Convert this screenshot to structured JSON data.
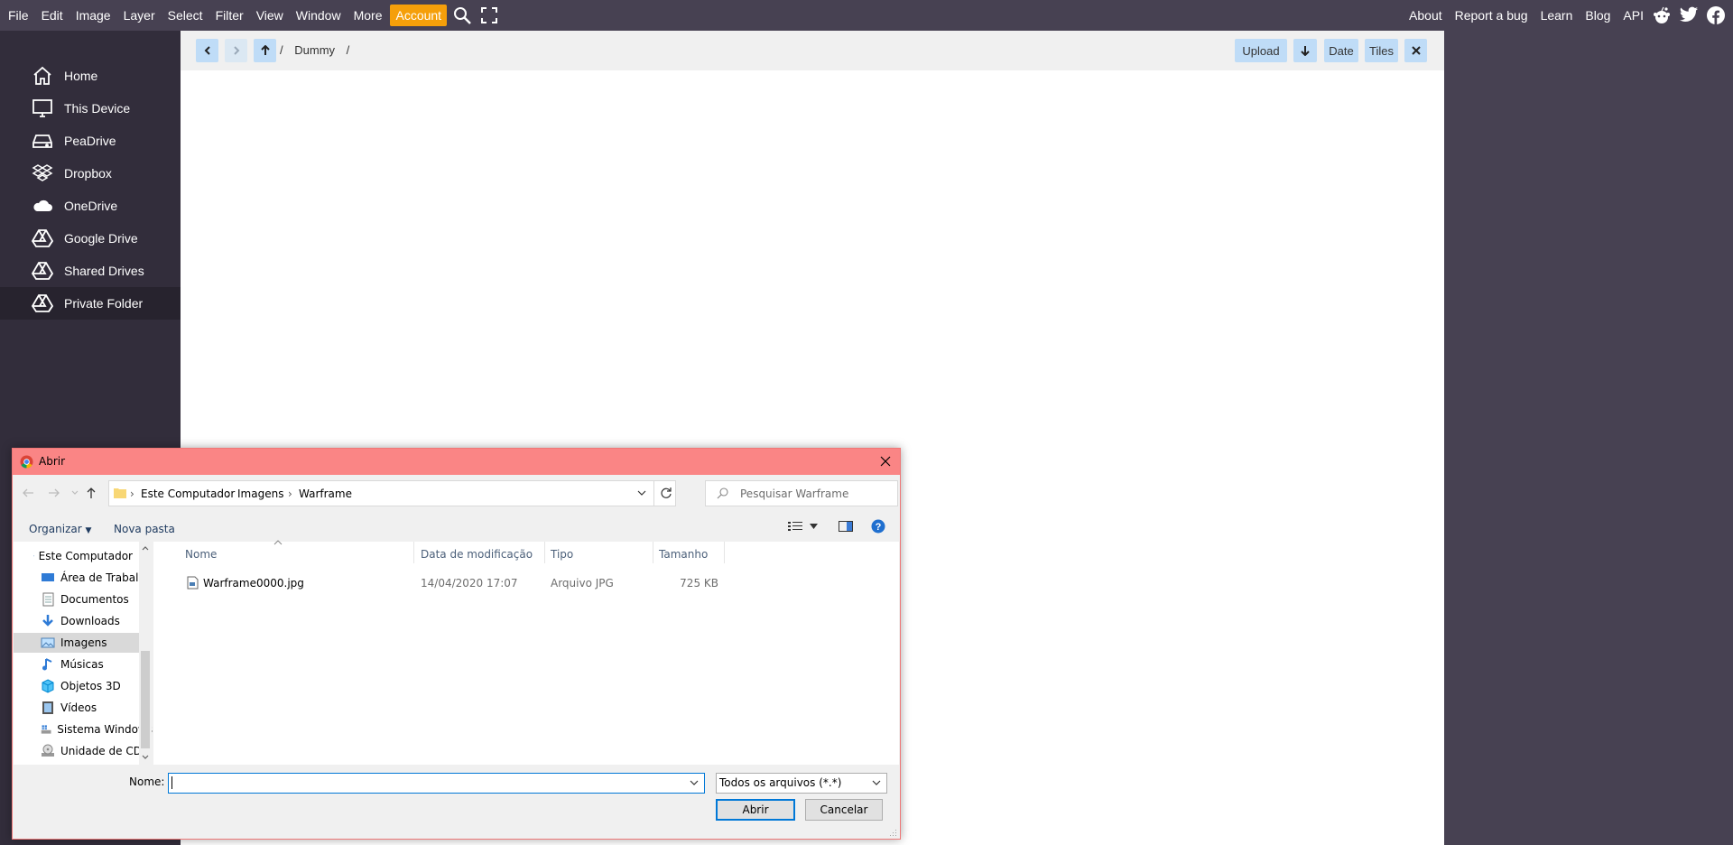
{
  "menubar": {
    "items": [
      "File",
      "Edit",
      "Image",
      "Layer",
      "Select",
      "Filter",
      "View",
      "Window",
      "More"
    ],
    "account": "Account",
    "right_items": [
      "About",
      "Report a bug",
      "Learn",
      "Blog",
      "API"
    ]
  },
  "sidebar": {
    "items": [
      {
        "label": "Home",
        "icon": "home-icon"
      },
      {
        "label": "This Device",
        "icon": "monitor-icon"
      },
      {
        "label": "PeaDrive",
        "icon": "drive-icon"
      },
      {
        "label": "Dropbox",
        "icon": "dropbox-icon"
      },
      {
        "label": "OneDrive",
        "icon": "cloud-icon"
      },
      {
        "label": "Google Drive",
        "icon": "google-drive-icon"
      },
      {
        "label": "Shared Drives",
        "icon": "google-drive-icon"
      },
      {
        "label": "Private Folder",
        "icon": "google-drive-icon"
      }
    ],
    "active_index": 7
  },
  "toolbar": {
    "path_sep": "/",
    "path_folder": "Dummy",
    "upload": "Upload",
    "date": "Date",
    "tiles": "Tiles"
  },
  "dialog": {
    "title": "Abrir",
    "address": [
      "Este Computador",
      "Imagens",
      "Warframe"
    ],
    "search_placeholder": "Pesquisar Warframe",
    "organize": "Organizar",
    "new_folder": "Nova pasta",
    "nav_items": [
      {
        "label": "Este Computador",
        "icon": "computer-icon"
      },
      {
        "label": "Área de Trabalho",
        "icon": "desktop-icon"
      },
      {
        "label": "Documentos",
        "icon": "documents-icon"
      },
      {
        "label": "Downloads",
        "icon": "download-arrow-icon"
      },
      {
        "label": "Imagens",
        "icon": "pictures-icon"
      },
      {
        "label": "Músicas",
        "icon": "music-icon"
      },
      {
        "label": "Objetos 3D",
        "icon": "objects-3d-icon"
      },
      {
        "label": "Vídeos",
        "icon": "videos-icon"
      },
      {
        "label": "Sistema Windows",
        "icon": "windows-drive-icon"
      },
      {
        "label": "Unidade de CD (",
        "icon": "cd-drive-icon"
      }
    ],
    "selected_nav": 4,
    "columns": [
      "Nome",
      "Data de modificação",
      "Tipo",
      "Tamanho"
    ],
    "files": [
      {
        "name": "Warframe0000.jpg",
        "date": "14/04/2020 17:07",
        "type": "Arquivo JPG",
        "size": "725 KB"
      }
    ],
    "name_label": "Nome:",
    "name_value": "",
    "filter": "Todos os arquivos (*.*)",
    "open": "Abrir",
    "cancel": "Cancelar"
  }
}
